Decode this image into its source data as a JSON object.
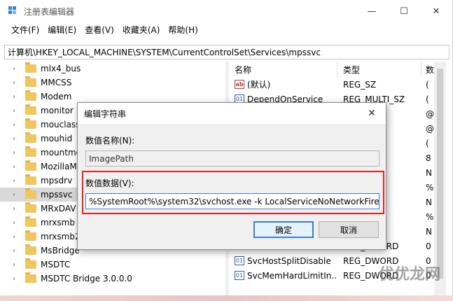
{
  "window": {
    "title": "注册表编辑器",
    "controls": [
      "—",
      "☐",
      "✕"
    ]
  },
  "menu": [
    "文件(F)",
    "编辑(E)",
    "查看(V)",
    "收藏夹(A)",
    "帮助(H)"
  ],
  "address": "计算机\\HKEY_LOCAL_MACHINE\\SYSTEM\\CurrentControlSet\\Services\\mpssvc",
  "tree": {
    "items": [
      {
        "label": "mlx4_bus"
      },
      {
        "label": "MMCSS"
      },
      {
        "label": "Modem"
      },
      {
        "label": "monitor"
      },
      {
        "label": "mouclass"
      },
      {
        "label": "mouhid"
      },
      {
        "label": "mountmgr"
      },
      {
        "label": "MozillaMa"
      },
      {
        "label": "mpsdrv"
      },
      {
        "label": "mpssvc"
      },
      {
        "label": "MRxDAV"
      },
      {
        "label": "mrxsmb"
      },
      {
        "label": "mrxsmb20"
      },
      {
        "label": "MsBridge"
      },
      {
        "label": "MSDTC"
      },
      {
        "label": "MSDTC Bridge 3.0.0.0"
      }
    ],
    "selected_index": 9
  },
  "list": {
    "headers": {
      "name": "名称",
      "type": "类型",
      "data": "数"
    },
    "rows": [
      {
        "icon": "ab",
        "name": "(默认)",
        "type": "REG_SZ",
        "data": "("
      },
      {
        "icon": "bin",
        "name": "DependOnService",
        "type": "REG_MULTI_SZ",
        "data": "("
      },
      {
        "icon": "",
        "name": "",
        "type": "",
        "data": "@"
      },
      {
        "icon": "",
        "name": "",
        "type": "",
        "data": "@"
      },
      {
        "icon": "",
        "name": "",
        "type": "DWORD",
        "data": "("
      },
      {
        "icon": "",
        "name": "",
        "type": "RY",
        "data": "8"
      },
      {
        "icon": "",
        "name": "",
        "type": "",
        "data": "N"
      },
      {
        "icon": "",
        "name": "",
        "type": "ND_SZ",
        "data": "%"
      },
      {
        "icon": "",
        "name": "",
        "type": "",
        "data": "N"
      },
      {
        "icon": "",
        "name": "",
        "type": "SZ",
        "data": "%"
      },
      {
        "icon": "",
        "name": "",
        "type": "",
        "data": "N"
      },
      {
        "icon": "",
        "name": "Start",
        "type": "REG_DWORD",
        "data": "0"
      },
      {
        "icon": "bin",
        "name": "SvcHostSplitDisable",
        "type": "REG_DWORD",
        "data": "0"
      },
      {
        "icon": "bin",
        "name": "SvcMemHardLimitIn...",
        "type": "REG_DWORD",
        "data": "0"
      }
    ]
  },
  "dialog": {
    "title": "编辑字符串",
    "close": "✕",
    "name_label": "数值名称(N):",
    "name_value": "ImagePath",
    "data_label": "数值数据(V):",
    "data_before_caret": "%SystemRoot%\\system",
    "data_after_caret": "32\\svchost.exe -k LocalServiceNoNetworkFirewall",
    "ok": "确定",
    "cancel": "取消"
  },
  "watermark": "优优龙网",
  "colors": {
    "highlight_box": "#e02020",
    "accent": "#3b7fd1",
    "folder": "#f0c75e"
  }
}
